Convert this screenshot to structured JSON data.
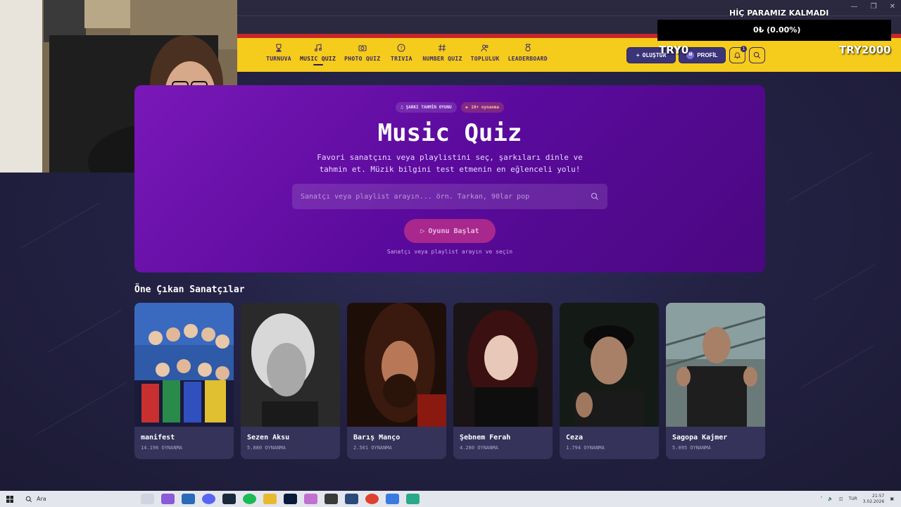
{
  "overlay": {
    "headline": "HİÇ PARAMIZ KALMADI",
    "balance": "0₺ (0.00%)",
    "left_tag": "TRY0",
    "right_tag": "TRY2000"
  },
  "nav": {
    "items": [
      {
        "label": "TURNUVA",
        "icon": "trophy-icon"
      },
      {
        "label": "MUSIC QUIZ",
        "icon": "music-note-icon"
      },
      {
        "label": "PHOTO QUIZ",
        "icon": "camera-icon"
      },
      {
        "label": "TRIVIA",
        "icon": "question-bubble-icon"
      },
      {
        "label": "NUMBER QUIZ",
        "icon": "hash-icon"
      },
      {
        "label": "TOPLULUK",
        "icon": "users-icon"
      },
      {
        "label": "LEADERBOARD",
        "icon": "medal-icon"
      }
    ],
    "create_label": "OLUŞTUR",
    "profile_label": "PROFİL",
    "avatar_letter": "M",
    "notification_count": "1"
  },
  "hero": {
    "pill_game": "ŞARKI TAHMİN OYUNU",
    "pill_players": "10+ oynanma",
    "title": "Music Quiz",
    "description": "Favori sanatçını veya playlistini seç, şarkıları dinle ve tahmin et. Müzik bilgini test etmenin en eğlenceli yolu!",
    "search_placeholder": "Sanatçı veya playlist arayın... örn. Tarkan, 90lar pop",
    "start_label": "Oyunu Başlat",
    "hint": "Sanatçı veya playlist arayın ve seçin"
  },
  "featured": {
    "title": "Öne Çıkan Sanatçılar",
    "artists": [
      {
        "name": "manifest",
        "plays": "14.196 OYNANMA"
      },
      {
        "name": "Sezen Aksu",
        "plays": "5.880 OYNANMA"
      },
      {
        "name": "Barış Manço",
        "plays": "2.501 OYNANMA"
      },
      {
        "name": "Şebnem Ferah",
        "plays": "4.280 OYNANMA"
      },
      {
        "name": "Ceza",
        "plays": "1.794 OYNANMA"
      },
      {
        "name": "Sagopa Kajmer",
        "plays": "5.095 OYNANMA"
      }
    ]
  },
  "taskbar": {
    "search_label": "Ara",
    "language": "TUR",
    "time": "21:57",
    "date": "3.02.2026"
  },
  "colors": {
    "nav_yellow": "#f5cb1c",
    "hero_purple": "#6a10a8",
    "accent_pink": "#a8288e"
  }
}
